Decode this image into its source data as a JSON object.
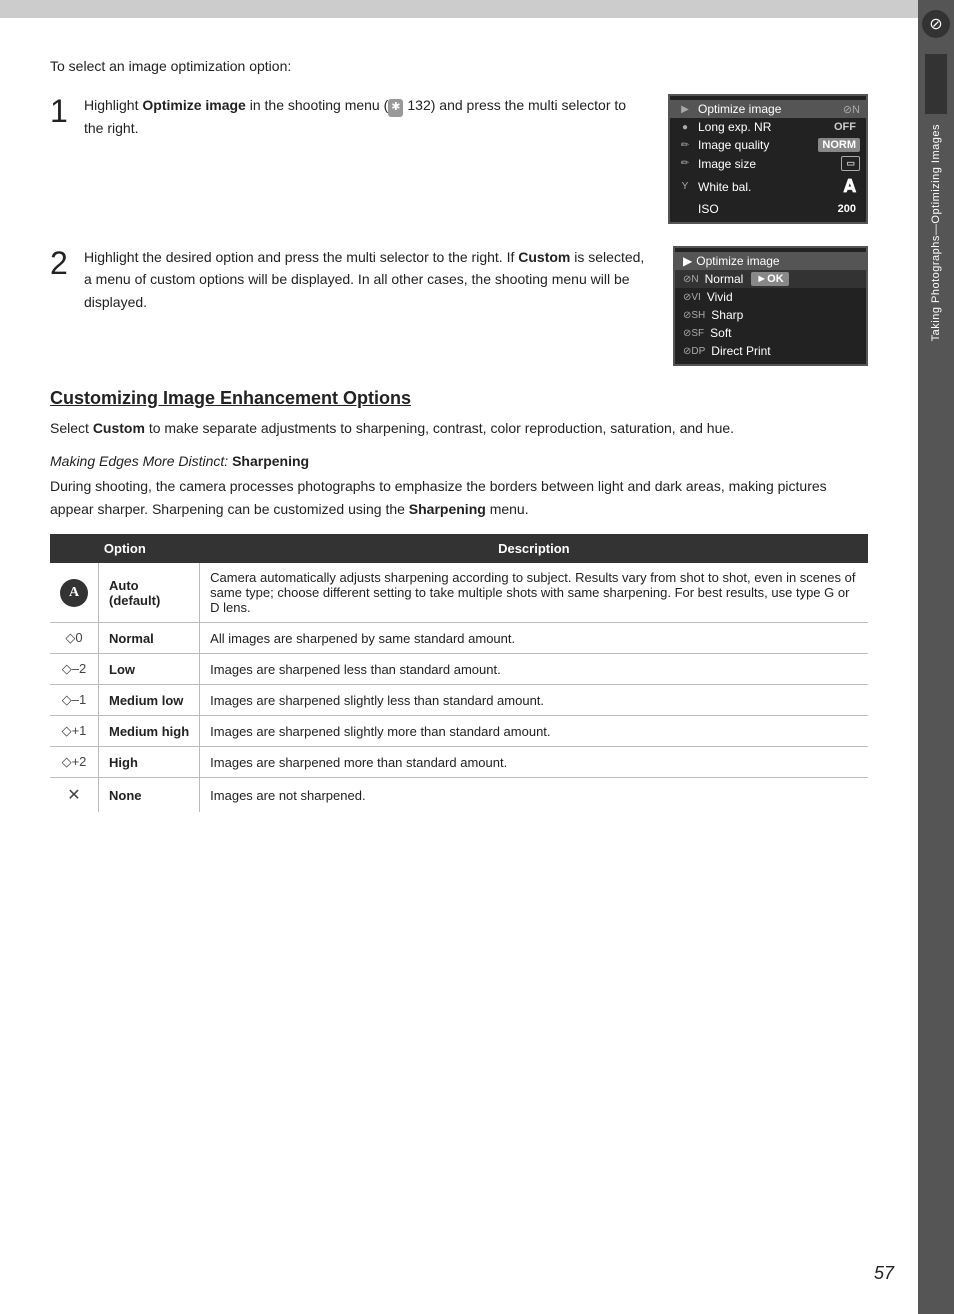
{
  "page": {
    "number": "57",
    "top_bar_height": 18
  },
  "sidebar": {
    "icon_label": "⊘",
    "text": "Taking Photographs—Optimizing Images"
  },
  "intro": {
    "text": "To select an image optimization option:"
  },
  "step1": {
    "number": "1",
    "text_before": "Highlight ",
    "bold": "Optimize image",
    "text_after": " in the shooting menu (",
    "icon": "✱",
    "page_ref": "132) and press the multi selector to the right."
  },
  "step2": {
    "number": "2",
    "text": "Highlight the desired option and press the multi selector to the right.  If ",
    "bold": "Custom",
    "text2": " is selected, a menu of custom options will be displayed.  In all other cases, the shooting menu will be displayed."
  },
  "camera_menu1": {
    "title": "Optimize image ⊘N",
    "rows": [
      {
        "icon": "▶",
        "label": "Optimize image",
        "value": "⊘N",
        "type": "title"
      },
      {
        "icon": "●",
        "label": "Long exp. NR",
        "value": "OFF",
        "type": "off"
      },
      {
        "icon": "✏",
        "label": "Image quality",
        "value": "NORM",
        "type": "norm"
      },
      {
        "icon": "✏",
        "label": "Image size",
        "value": "▭",
        "type": "size"
      },
      {
        "icon": "Υ",
        "label": "White bal.",
        "value": "A",
        "type": "A"
      },
      {
        "icon": "",
        "label": "ISO",
        "value": "200",
        "type": "num"
      }
    ]
  },
  "camera_menu2": {
    "title": "Optimize image",
    "rows": [
      {
        "icon": "⊘N",
        "label": "Normal",
        "value": "►OK",
        "selected": true
      },
      {
        "icon": "⊘VI",
        "label": "Vivid",
        "value": ""
      },
      {
        "icon": "⊘SH",
        "label": "Sharp",
        "value": ""
      },
      {
        "icon": "⊘SF",
        "label": "Soft",
        "value": ""
      },
      {
        "icon": "⊘DP",
        "label": "Direct Print",
        "value": ""
      }
    ]
  },
  "section": {
    "heading": "Customizing Image Enhancement Options",
    "subtext": "Select ",
    "bold": "Custom",
    "subtext2": " to make separate adjustments to sharpening, contrast, color reproduction, saturation, and hue.",
    "subsection_heading_italic": "Making Edges More Distinct: ",
    "subsection_heading_bold": "Sharpening",
    "subsection_body": "During shooting, the camera processes photographs to emphasize the borders between light and dark areas, making pictures appear sharper.  Sharpening can be customized using the ",
    "subsection_body_bold": "Sharpening",
    "subsection_body_end": " menu.",
    "table": {
      "col1": "Option",
      "col2": "Description",
      "rows": [
        {
          "icon": "A",
          "icon_type": "circle",
          "name": "Auto",
          "name_sub": "(default)",
          "description": "Camera automatically adjusts sharpening according to subject.  Results vary from shot to shot, even in scenes of same type; choose different setting to take multiple shots with same sharpening.  For best results, use type G or D lens."
        },
        {
          "icon": "◇0",
          "icon_type": "diamond",
          "name": "Normal",
          "name_sub": "",
          "description": "All images are sharpened by same standard amount."
        },
        {
          "icon": "◇–2",
          "icon_type": "diamond",
          "name": "Low",
          "name_sub": "",
          "description": "Images are sharpened less than standard amount."
        },
        {
          "icon": "◇–1",
          "icon_type": "diamond",
          "name": "Medium low",
          "name_sub": "",
          "description": "Images are sharpened slightly less than standard amount."
        },
        {
          "icon": "◇+1",
          "icon_type": "diamond",
          "name": "Medium high",
          "name_sub": "",
          "description": "Images are sharpened slightly more than standard amount."
        },
        {
          "icon": "◇+2",
          "icon_type": "diamond",
          "name": "High",
          "name_sub": "",
          "description": "Images are sharpened more than standard amount."
        },
        {
          "icon": "✕",
          "icon_type": "cross",
          "name": "None",
          "name_sub": "",
          "description": "Images are not sharpened."
        }
      ]
    }
  }
}
